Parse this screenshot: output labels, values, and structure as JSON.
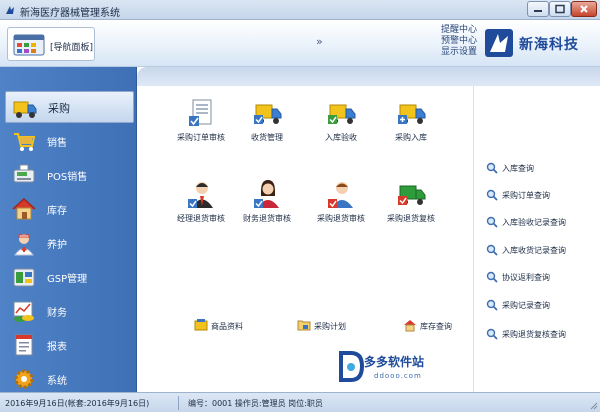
{
  "window": {
    "title": "新海医疗器械管理系统"
  },
  "header": {
    "nav_panel_label": "[导航面板]",
    "links": [
      "提醒中心",
      "预警中心",
      "显示设置"
    ],
    "brand": "新海科技",
    "chevron": "»"
  },
  "sidebar": {
    "items": [
      {
        "label": "采购",
        "icon": "truck-icon",
        "active": true
      },
      {
        "label": "销售",
        "icon": "cart-icon",
        "active": false
      },
      {
        "label": "POS销售",
        "icon": "pos-terminal-icon",
        "active": false
      },
      {
        "label": "库存",
        "icon": "house-icon",
        "active": false
      },
      {
        "label": "养护",
        "icon": "nurse-icon",
        "active": false
      },
      {
        "label": "GSP管理",
        "icon": "gsp-box-icon",
        "active": false
      },
      {
        "label": "财务",
        "icon": "money-chart-icon",
        "active": false
      },
      {
        "label": "报表",
        "icon": "report-icon",
        "active": false
      },
      {
        "label": "系统",
        "icon": "gear-icon",
        "active": false
      }
    ]
  },
  "functions": [
    {
      "label": "采购订单审核",
      "icon": "document-check-icon"
    },
    {
      "label": "收货管理",
      "icon": "truck-receive-icon"
    },
    {
      "label": "入库验收",
      "icon": "truck-check-icon"
    },
    {
      "label": "采购入库",
      "icon": "truck-stock-in-icon"
    },
    {
      "label": "经理退货审核",
      "icon": "manager-icon"
    },
    {
      "label": "财务退货审核",
      "icon": "finance-woman-icon"
    },
    {
      "label": "采购退货审核",
      "icon": "buyer-icon"
    },
    {
      "label": "采购退货复核",
      "icon": "truck-return-icon"
    }
  ],
  "quick_links": [
    {
      "label": "商品资料",
      "icon": "goods-data-icon"
    },
    {
      "label": "采购计划",
      "icon": "folder-plan-icon"
    },
    {
      "label": "库存查询",
      "icon": "warehouse-icon"
    }
  ],
  "queries": [
    "入库查询",
    "采购订单查询",
    "入库验收记录查询",
    "入库收货记录查询",
    "协议返利查询",
    "采购记录查询",
    "采购退货复核查询"
  ],
  "watermark": {
    "name": "多多软件站",
    "url": "ddooo.com"
  },
  "status": {
    "date": "2016年9月16日(帐套:2016年9月16日)",
    "user": "编号：0001 操作员:管理员 岗位:职员"
  },
  "colors": {
    "sidebar": "#4677bd",
    "brand": "#1f4b9a",
    "close": "#c6452d"
  }
}
